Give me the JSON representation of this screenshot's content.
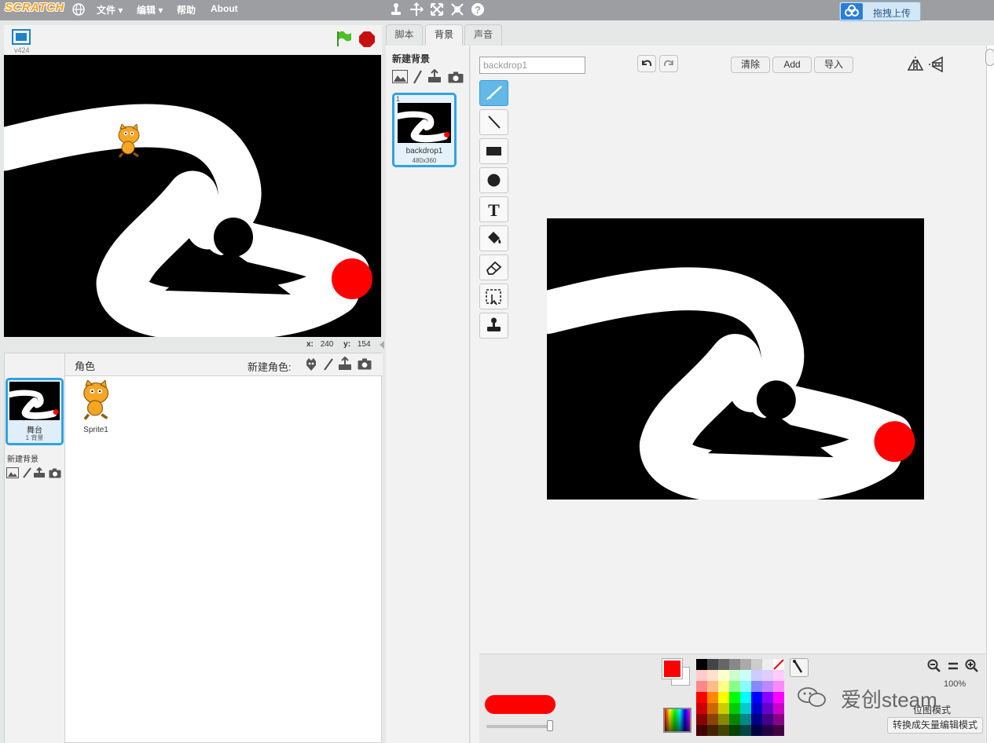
{
  "app": {
    "logo": "SCRATCH",
    "version": "v424"
  },
  "menubar": {
    "items": [
      "文件 ▾",
      "编辑 ▾",
      "帮助",
      "About"
    ],
    "upload_label": "拖拽上传",
    "toolbar_icons": [
      "duplicate-icon",
      "cut-icon",
      "grow-icon",
      "shrink-icon",
      "help-icon"
    ]
  },
  "stage": {
    "coord_x_label": "x:",
    "coord_x_value": "240",
    "coord_y_label": "y:",
    "coord_y_value": "154"
  },
  "sprites": {
    "header_label": "角色",
    "new_sprite_label": "新建角色:",
    "stage_thumb": {
      "name": "舞台",
      "sub": "1 背景"
    },
    "new_backdrop_label": "新建背景",
    "items": [
      {
        "name": "Sprite1"
      }
    ]
  },
  "tabs": [
    {
      "label": "脚本",
      "active": false
    },
    {
      "label": "背景",
      "active": true
    },
    {
      "label": "声音",
      "active": false
    }
  ],
  "backdrops": {
    "header": "新建背景",
    "items": [
      {
        "index": "1",
        "name": "backdrop1",
        "size": "480x360"
      }
    ]
  },
  "paint_editor": {
    "name_value": "backdrop1",
    "clear_label": "清除",
    "add_label": "Add",
    "import_label": "导入",
    "tools": [
      "brush-icon",
      "line-icon",
      "rectangle-icon",
      "ellipse-icon",
      "text-icon",
      "fill-icon",
      "eraser-icon",
      "select-icon",
      "stamp-icon"
    ],
    "selected_tool": "brush-icon",
    "zoom": "100%",
    "mode_label": "位图模式",
    "convert_label": "转换成矢量编辑模式",
    "primary_color": "#ff0000",
    "secondary_color": "#ffffff"
  },
  "watermark": "爱创steam"
}
